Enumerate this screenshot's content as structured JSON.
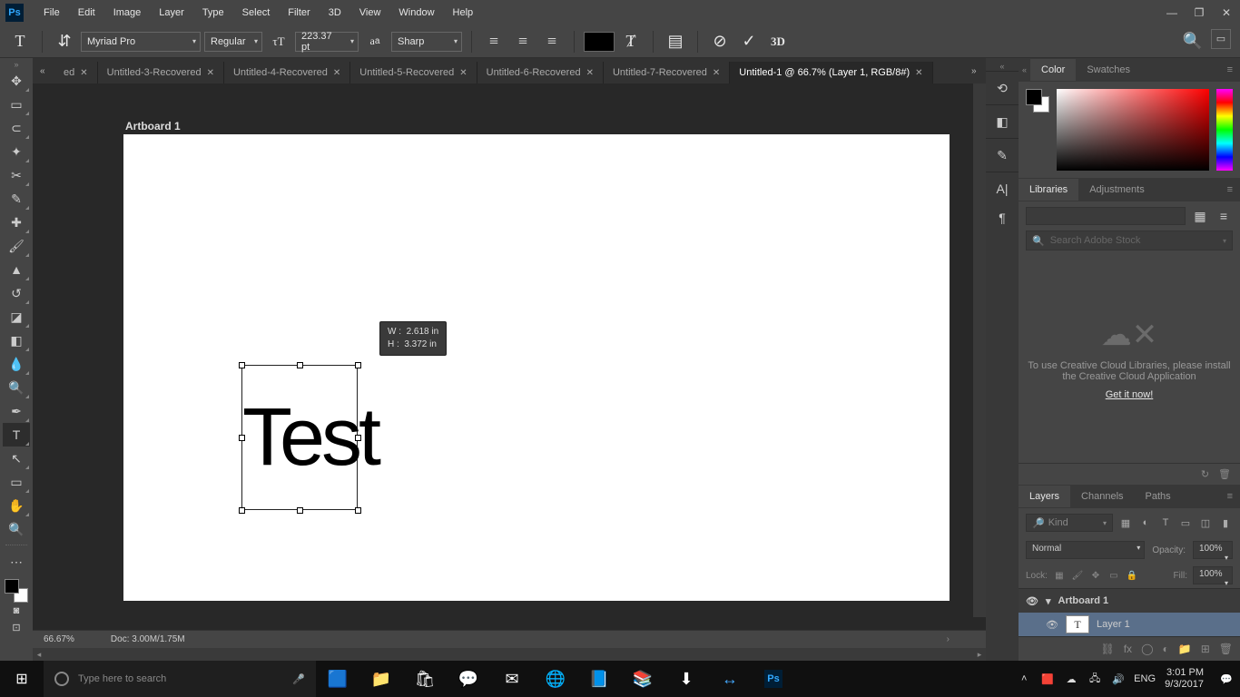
{
  "menu": {
    "items": [
      "File",
      "Edit",
      "Image",
      "Layer",
      "Type",
      "Select",
      "Filter",
      "3D",
      "View",
      "Window",
      "Help"
    ]
  },
  "options": {
    "font_family": "Myriad Pro",
    "font_style": "Regular",
    "font_size": "223.37 pt",
    "antialias": "Sharp",
    "threeD": "3D"
  },
  "tabs": {
    "partial": "ed",
    "items": [
      {
        "label": "Untitled-3-Recovered",
        "active": false
      },
      {
        "label": "Untitled-4-Recovered",
        "active": false
      },
      {
        "label": "Untitled-5-Recovered",
        "active": false
      },
      {
        "label": "Untitled-6-Recovered",
        "active": false
      },
      {
        "label": "Untitled-7-Recovered",
        "active": false
      },
      {
        "label": "Untitled-1 @ 66.7% (Layer 1, RGB/8#)",
        "active": true
      }
    ]
  },
  "artboard": {
    "label": "Artboard 1",
    "text": "Test"
  },
  "tooltip": {
    "w_label": "W :",
    "w_val": "2.618 in",
    "h_label": "H :",
    "h_val": "3.372 in"
  },
  "status": {
    "zoom": "66.67%",
    "doc": "Doc: 3.00M/1.75M"
  },
  "right_tabs": {
    "color": "Color",
    "swatches": "Swatches",
    "libraries": "Libraries",
    "adjustments": "Adjustments",
    "layers": "Layers",
    "channels": "Channels",
    "paths": "Paths"
  },
  "libraries": {
    "search_placeholder": "Search Adobe Stock",
    "msg": "To use Creative Cloud Libraries, please install the Creative Cloud Application",
    "link": "Get it now!"
  },
  "layers": {
    "kind": "Kind",
    "blend": "Normal",
    "opacity_label": "Opacity:",
    "opacity": "100%",
    "lock_label": "Lock:",
    "fill_label": "Fill:",
    "fill": "100%",
    "group_name": "Artboard 1",
    "layer_name": "Layer 1"
  },
  "taskbar": {
    "search_placeholder": "Type here to search",
    "lang": "ENG",
    "time": "3:01 PM",
    "date": "9/3/2017"
  }
}
